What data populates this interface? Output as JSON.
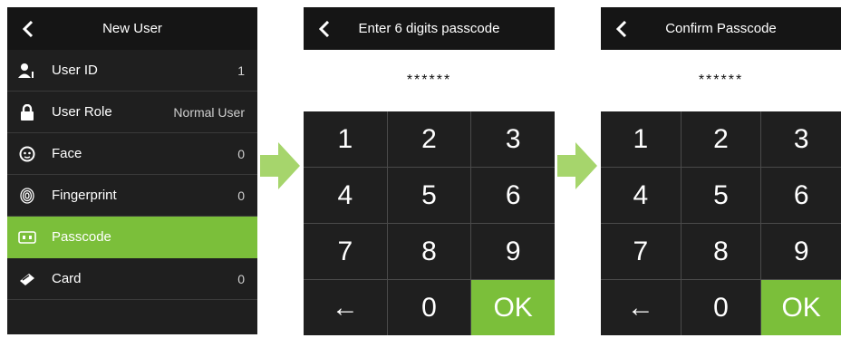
{
  "screen1": {
    "title": "New User",
    "items": [
      {
        "label": "User ID",
        "value": "1",
        "icon": "user-id-icon",
        "active": false
      },
      {
        "label": "User Role",
        "value": "Normal User",
        "icon": "lock-icon",
        "active": false
      },
      {
        "label": "Face",
        "value": "0",
        "icon": "face-icon",
        "active": false
      },
      {
        "label": "Fingerprint",
        "value": "0",
        "icon": "fingerprint-icon",
        "active": false
      },
      {
        "label": "Passcode",
        "value": "",
        "icon": "passcode-icon",
        "active": true
      },
      {
        "label": "Card",
        "value": "0",
        "icon": "card-icon",
        "active": false
      }
    ]
  },
  "screen2": {
    "title": "Enter 6 digits passcode",
    "display": "******",
    "keys": [
      "1",
      "2",
      "3",
      "4",
      "5",
      "6",
      "7",
      "8",
      "9",
      "←",
      "0",
      "OK"
    ]
  },
  "screen3": {
    "title": "Confirm Passcode",
    "display": "******",
    "keys": [
      "1",
      "2",
      "3",
      "4",
      "5",
      "6",
      "7",
      "8",
      "9",
      "←",
      "0",
      "OK"
    ]
  },
  "colors": {
    "accent": "#7bbf3a",
    "arrow": "#a6d56c",
    "dark": "#1f1f1f",
    "header": "#151515"
  }
}
